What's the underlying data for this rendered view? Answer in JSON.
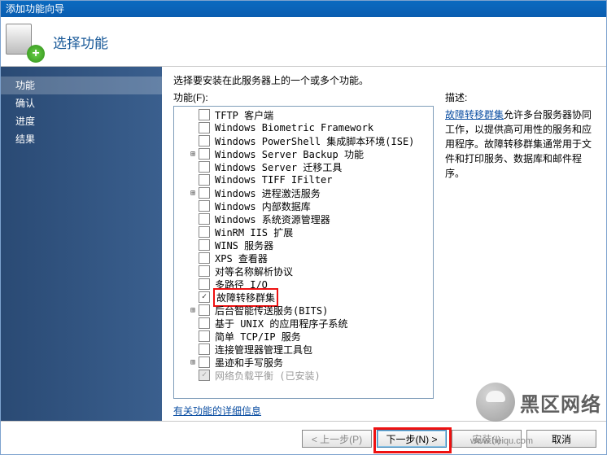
{
  "window": {
    "title": "添加功能向导"
  },
  "header": {
    "title": "选择功能"
  },
  "sidebar": {
    "items": [
      {
        "label": "功能",
        "selected": true
      },
      {
        "label": "确认"
      },
      {
        "label": "进度"
      },
      {
        "label": "结果"
      }
    ]
  },
  "main": {
    "intro": "选择要安装在此服务器上的一个或多个功能。",
    "list_label": "功能(F):",
    "more_link": "有关功能的详细信息",
    "features": [
      {
        "label": "TFTP 客户端",
        "indent": 1
      },
      {
        "label": "Windows Biometric Framework",
        "indent": 1
      },
      {
        "label": "Windows PowerShell 集成脚本环境(ISE)",
        "indent": 1
      },
      {
        "label": "Windows Server Backup 功能",
        "indent": 1,
        "expander": "plus"
      },
      {
        "label": "Windows Server 迁移工具",
        "indent": 1
      },
      {
        "label": "Windows TIFF IFilter",
        "indent": 1
      },
      {
        "label": "Windows 进程激活服务",
        "indent": 1,
        "expander": "plus"
      },
      {
        "label": "Windows 内部数据库",
        "indent": 1
      },
      {
        "label": "Windows 系统资源管理器",
        "indent": 1
      },
      {
        "label": "WinRM IIS 扩展",
        "indent": 1
      },
      {
        "label": "WINS 服务器",
        "indent": 1
      },
      {
        "label": "XPS 查看器",
        "indent": 1
      },
      {
        "label": "对等名称解析协议",
        "indent": 1
      },
      {
        "label": "多路径 I/O",
        "indent": 1
      },
      {
        "label": "故障转移群集",
        "indent": 1,
        "checked": true,
        "highlight": true
      },
      {
        "label": "后台智能传送服务(BITS)",
        "indent": 1,
        "expander": "plus"
      },
      {
        "label": "基于 UNIX 的应用程序子系统",
        "indent": 1
      },
      {
        "label": "简单 TCP/IP 服务",
        "indent": 1
      },
      {
        "label": "连接管理器管理工具包",
        "indent": 1
      },
      {
        "label": "墨迹和手写服务",
        "indent": 1,
        "expander": "plus"
      },
      {
        "label": "网络负载平衡  (已安装)",
        "indent": 1,
        "checked": true,
        "disabled": true
      }
    ]
  },
  "description": {
    "label": "描述:",
    "link_text": "故障转移群集",
    "body": "允许多台服务器协同工作，以提供高可用性的服务和应用程序。故障转移群集通常用于文件和打印服务、数据库和邮件程序。"
  },
  "buttons": {
    "prev": "< 上一步(P)",
    "next": "下一步(N) >",
    "install": "安装(I)",
    "cancel": "取消"
  },
  "watermark": {
    "brand": "黑区网络",
    "url": "www.heiqu.com"
  }
}
